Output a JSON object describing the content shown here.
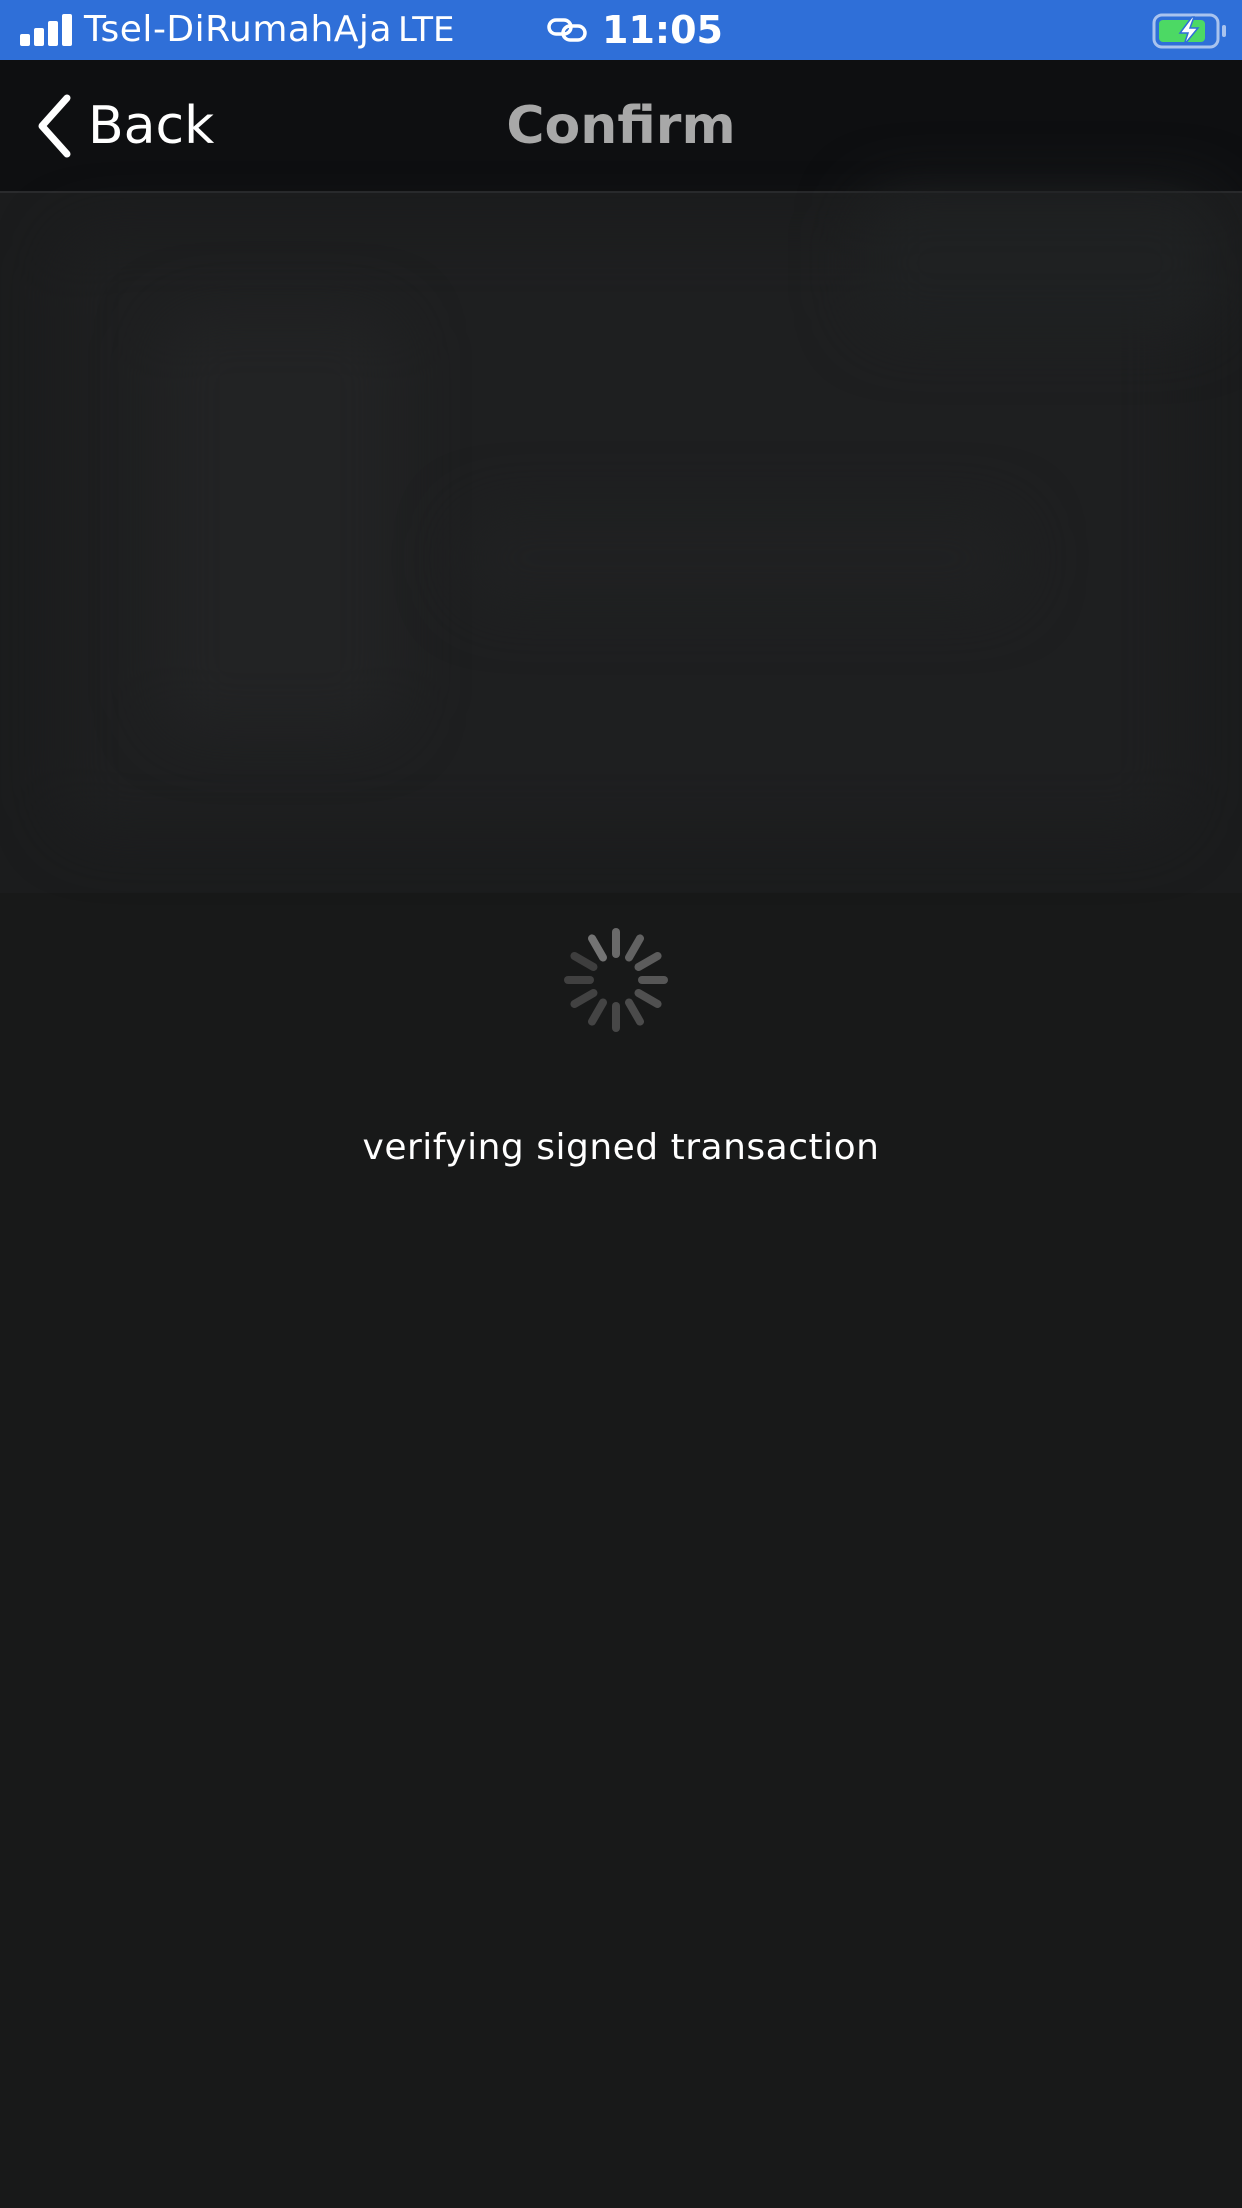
{
  "status_bar": {
    "carrier": "Tsel-DiRumahAja",
    "network": "LTE",
    "time": "11:05",
    "signal_icon": "signal-bars-icon",
    "link_icon": "link-icon",
    "battery_icon": "battery-charging-icon",
    "background_color": "#2f6fd8",
    "battery_color": "#4cd964"
  },
  "nav_bar": {
    "back_label": "Back",
    "back_icon": "chevron-left-icon",
    "title": "Confirm"
  },
  "loading": {
    "spinner_icon": "activity-spinner-icon",
    "message": "verifying signed transaction"
  }
}
